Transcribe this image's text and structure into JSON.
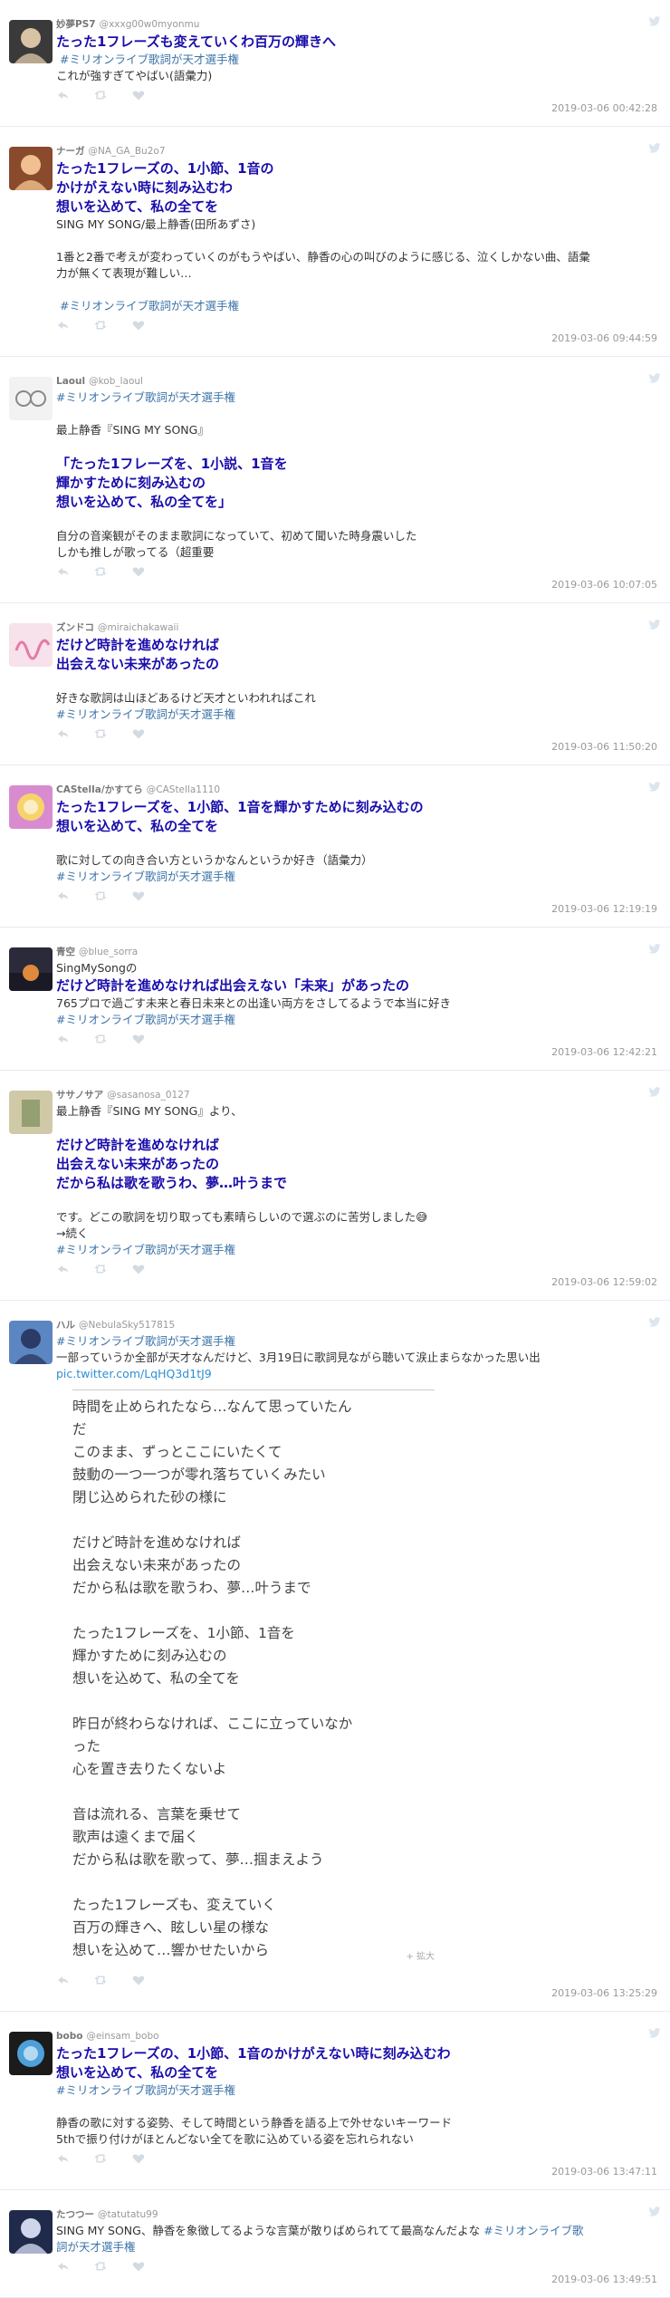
{
  "tweets": [
    {
      "name": "妙夢PS7",
      "handle": "@xxxg00w0myonmu",
      "lines": [
        {
          "t": "たった1フレーズも変えていくわ百万の輝きへ",
          "s": "hl"
        },
        {
          "t": " #ミリオンライブ歌詞が天才選手権",
          "s": "tag"
        },
        {
          "t": "これが強すぎてやばい(語彙力)",
          "s": ""
        }
      ],
      "timestamp": "2019-03-06 00:42:28",
      "avatar": {
        "bg": "#3a3a3a",
        "fg": "#d8c3a5",
        "icon": "character-avatar-icon"
      }
    },
    {
      "name": "ナーガ",
      "handle": "@NA_GA_Bu2o7",
      "lines": [
        {
          "t": "たった1フレーズの、1小節、1音の",
          "s": "hl"
        },
        {
          "t": "かけがえない時に刻み込むわ",
          "s": "hl"
        },
        {
          "t": "想いを込めて、私の全てを",
          "s": "hl"
        },
        {
          "t": "SING MY SONG/最上静香(田所あずさ)",
          "s": ""
        },
        {
          "t": "",
          "s": ""
        },
        {
          "t": "1番と2番で考えが変わっていくのがもうやばい、静香の心の叫びのように感じる、泣くしかない曲、語彙",
          "s": ""
        },
        {
          "t": "力が無くて表現が難しい…",
          "s": ""
        },
        {
          "t": "",
          "s": ""
        },
        {
          "t": " #ミリオンライブ歌詞が天才選手権",
          "s": "tag"
        }
      ],
      "timestamp": "2019-03-06 09:44:59",
      "avatar": {
        "bg": "#8a4a2c",
        "fg": "#f0c090",
        "icon": "character-avatar-icon"
      }
    },
    {
      "name": "Laoul",
      "handle": "@kob_laoul",
      "lines": [
        {
          "t": "#ミリオンライブ歌詞が天才選手権",
          "s": "tag"
        },
        {
          "t": "",
          "s": ""
        },
        {
          "t": "最上静香『SING MY SONG』",
          "s": ""
        },
        {
          "t": "",
          "s": ""
        },
        {
          "t": "「たった1フレーズを、1小説、1音を",
          "s": "hl"
        },
        {
          "t": "輝かすために刻み込むの",
          "s": "hl"
        },
        {
          "t": "想いを込めて、私の全てを」",
          "s": "hl"
        },
        {
          "t": "",
          "s": ""
        },
        {
          "t": "自分の音楽観がそのまま歌詞になっていて、初めて聞いた時身震いした",
          "s": ""
        },
        {
          "t": "しかも推しが歌ってる（超重要",
          "s": ""
        }
      ],
      "timestamp": "2019-03-06 10:07:05",
      "avatar": {
        "bg": "#f2f2f2",
        "fg": "#888888",
        "icon": "glasses-avatar-icon"
      }
    },
    {
      "name": "ズンドコ",
      "handle": "@miraichakawaii",
      "lines": [
        {
          "t": "だけど時計を進めなければ",
          "s": "hl"
        },
        {
          "t": "出会えない未来があったの",
          "s": "hl"
        },
        {
          "t": "",
          "s": ""
        },
        {
          "t": "好きな歌詞は山ほどあるけど天才といわれればこれ",
          "s": ""
        },
        {
          "t": "#ミリオンライブ歌詞が天才選手権",
          "s": "tag"
        }
      ],
      "timestamp": "2019-03-06 11:50:20",
      "avatar": {
        "bg": "#f7e1ea",
        "fg": "#e37aa5",
        "icon": "pink-lettering-avatar-icon"
      }
    },
    {
      "name": "CAStella/かすてら",
      "handle": "@CAStella1110",
      "lines": [
        {
          "t": "たった1フレーズを、1小節、1音を輝かすために刻み込むの",
          "s": "hl"
        },
        {
          "t": "想いを込めて、私の全てを",
          "s": "hl"
        },
        {
          "t": "",
          "s": ""
        },
        {
          "t": "歌に対しての向き合い方というかなんというか好き（語彙力）",
          "s": ""
        },
        {
          "t": "#ミリオンライブ歌詞が天才選手権",
          "s": "tag"
        }
      ],
      "timestamp": "2019-03-06 12:19:19",
      "avatar": {
        "bg": "#d98bd0",
        "fg": "#f6d36b",
        "icon": "emblem-avatar-icon"
      }
    },
    {
      "name": "青空",
      "handle": "@blue_sorra",
      "lines": [
        {
          "t": "SingMySongの",
          "s": ""
        },
        {
          "t": "だけど時計を進めなければ出会えない「未来」があったの",
          "s": "hl"
        },
        {
          "t": "765プロで過ごす未来と春日未来との出逢い両方をさしてるようで本当に好き",
          "s": ""
        },
        {
          "t": "#ミリオンライブ歌詞が天才選手権",
          "s": "tag"
        }
      ],
      "timestamp": "2019-03-06 12:42:21",
      "avatar": {
        "bg": "#2b2a3a",
        "fg": "#e08a3c",
        "icon": "sunset-avatar-icon"
      }
    },
    {
      "name": "ササノサア",
      "handle": "@sasanosa_0127",
      "lines": [
        {
          "t": "最上静香『SING MY SONG』より、",
          "s": ""
        },
        {
          "t": "",
          "s": ""
        },
        {
          "t": "だけど時計を進めなければ",
          "s": "hl"
        },
        {
          "t": "出会えない未来があったの",
          "s": "hl"
        },
        {
          "t": "だから私は歌を歌うわ、夢…叶うまで",
          "s": "hl"
        },
        {
          "t": "",
          "s": ""
        },
        {
          "t": "です。どこの歌詞を切り取っても素晴らしいので選ぶのに苦労しました😅",
          "s": ""
        },
        {
          "t": "→続く",
          "s": ""
        },
        {
          "t": "#ミリオンライブ歌詞が天才選手権",
          "s": "tag"
        }
      ],
      "timestamp": "2019-03-06 12:59:02",
      "avatar": {
        "bg": "#cfc9a8",
        "fg": "#7a8f5a",
        "icon": "figure-avatar-icon"
      }
    },
    {
      "name": "ハル",
      "handle": "@NebulaSky517815",
      "lines": [
        {
          "t": "#ミリオンライブ歌詞が天才選手権",
          "s": "tag"
        },
        {
          "t": "一部っていうか全部が天才なんだけど、3月19日に歌詞見ながら聴いて涙止まらなかった思い出",
          "s": ""
        },
        {
          "t": "pic.twitter.com/LqHQ3d1tJ9",
          "s": "link"
        }
      ],
      "timestamp": "2019-03-06 13:25:29",
      "avatar": {
        "bg": "#5b86c2",
        "fg": "#2c3b66",
        "icon": "character-avatar-icon"
      },
      "image": {
        "lines": [
          "時間を止められたなら…なんて思っていたん",
          "だ",
          "このまま、ずっとここにいたくて",
          "鼓動の一つ一つが零れ落ちていくみたい",
          "閉じ込められた砂の様に",
          "",
          "だけど時計を進めなければ",
          "出会えない未来があったの",
          "だから私は歌を歌うわ、夢…叶うまで",
          "",
          "たった1フレーズを、1小節、1音を",
          "輝かすために刻み込むの",
          "想いを込めて、私の全てを",
          "",
          "昨日が終わらなければ、ここに立っていなか",
          "った",
          "心を置き去りたくないよ",
          "",
          "音は流れる、言葉を乗せて",
          "歌声は遠くまで届く",
          "だから私は歌を歌って、夢…掴まえよう",
          "",
          "たった1フレーズも、変えていく",
          "百万の輝きへ、眩しい星の様な",
          "想いを込めて…響かせたいから"
        ],
        "enlarge_label": "+ 拡大"
      }
    },
    {
      "name": "bobo",
      "handle": "@einsam_bobo",
      "lines": [
        {
          "t": "たった1フレーズの、1小節、1音のかけがえない時に刻み込むわ",
          "s": "hl"
        },
        {
          "t": "想いを込めて、私の全てを",
          "s": "hl"
        },
        {
          "t": "#ミリオンライブ歌詞が天才選手権",
          "s": "tag"
        },
        {
          "t": "",
          "s": ""
        },
        {
          "t": "静香の歌に対する姿勢、そして時間という静香を語る上で外せないキーワード",
          "s": ""
        },
        {
          "t": "5thで振り付けがほとんどない全てを歌に込めている姿を忘れられない",
          "s": ""
        }
      ],
      "timestamp": "2019-03-06 13:47:11",
      "avatar": {
        "bg": "#1b1b1b",
        "fg": "#4da0d9",
        "icon": "colorful-emblem-avatar-icon"
      }
    },
    {
      "name": "たつつー",
      "handle": "@tatutatu99",
      "lines": [
        {
          "t": "SING MY SONG、静香を象徴してるような言葉が散りばめられてて最高なんだよな #ミリオンライブ歌",
          "s": "mix",
          "split": "#ミリオンライブ歌"
        },
        {
          "t": "詞が天才選手権",
          "s": "tag"
        }
      ],
      "timestamp": "2019-03-06 13:49:51",
      "avatar": {
        "bg": "#202a4a",
        "fg": "#cfd6ec",
        "icon": "character-avatar-icon"
      }
    }
  ],
  "colors": {
    "highlight": "#1a0dab",
    "hashtag": "#3b73a8",
    "meta": "#999999",
    "divider": "#e6ecf0"
  },
  "icons": [
    "reply-icon",
    "retweet-icon",
    "like-icon",
    "twitter-bird-icon"
  ]
}
